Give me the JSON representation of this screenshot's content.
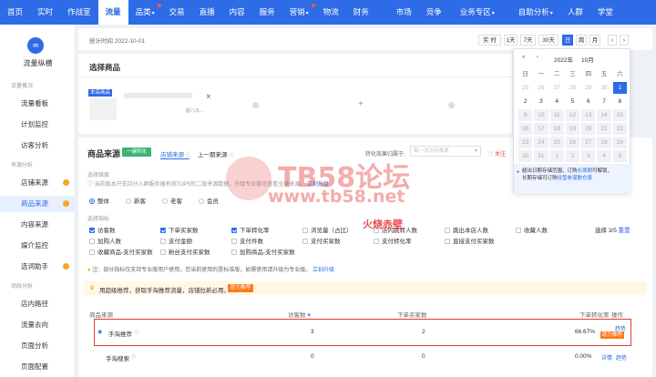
{
  "nav": {
    "items": [
      {
        "label": "首页"
      },
      {
        "label": "实时"
      },
      {
        "label": "作战室"
      },
      {
        "label": "流量",
        "active": true
      },
      {
        "label": "品类",
        "caret": true
      },
      {
        "label": "交易"
      },
      {
        "label": "直播"
      },
      {
        "label": "内容"
      },
      {
        "label": "服务"
      },
      {
        "label": "营销",
        "caret": true
      },
      {
        "label": "物流"
      },
      {
        "label": "财务"
      },
      {
        "label": "市场"
      },
      {
        "label": "竞争"
      },
      {
        "label": "业务专区",
        "caret": true
      },
      {
        "label": "自助分析",
        "caret": true
      },
      {
        "label": "人群"
      },
      {
        "label": "学堂"
      }
    ]
  },
  "sidebar": {
    "brand": "流量纵横",
    "groups": [
      {
        "label": "流量概况",
        "items": [
          "流量看板",
          "计划监控",
          "访客分析"
        ]
      },
      {
        "label": "来源分析",
        "items": [
          "店铺来源",
          "商品来源",
          "内容来源",
          "媒介监控",
          "选词助手"
        ]
      },
      {
        "label": "动线分析",
        "items": [
          "店内路径",
          "流量去向",
          "页面分析",
          "页面配置"
        ]
      }
    ],
    "active": "商品来源"
  },
  "stats_time": "统计时间 2022-10-01",
  "time_tabs": [
    "实 时",
    "1天",
    "7天",
    "30天",
    "日",
    "周",
    "月"
  ],
  "time_active": "日",
  "calendar": {
    "month_label": "2022年",
    "month": "10月",
    "weekdays": [
      "日",
      "一",
      "二",
      "三",
      "四",
      "五",
      "六"
    ],
    "rows": [
      [
        {
          "d": "25",
          "s": "prev"
        },
        {
          "d": "26",
          "s": "prev"
        },
        {
          "d": "27",
          "s": "prev"
        },
        {
          "d": "28",
          "s": "prev"
        },
        {
          "d": "29",
          "s": "prev"
        },
        {
          "d": "30",
          "s": "prev"
        },
        {
          "d": "1",
          "s": "sel"
        }
      ],
      [
        {
          "d": "2",
          "s": "n"
        },
        {
          "d": "3",
          "s": "n"
        },
        {
          "d": "4",
          "s": "n"
        },
        {
          "d": "5",
          "s": "n"
        },
        {
          "d": "6",
          "s": "n"
        },
        {
          "d": "7",
          "s": "n"
        },
        {
          "d": "8",
          "s": "n"
        }
      ],
      [
        {
          "d": "9",
          "s": "dis"
        },
        {
          "d": "10",
          "s": "dis"
        },
        {
          "d": "11",
          "s": "dis"
        },
        {
          "d": "12",
          "s": "dis"
        },
        {
          "d": "13",
          "s": "dis"
        },
        {
          "d": "14",
          "s": "dis"
        },
        {
          "d": "15",
          "s": "dis"
        }
      ],
      [
        {
          "d": "16",
          "s": "dis"
        },
        {
          "d": "17",
          "s": "dis"
        },
        {
          "d": "18",
          "s": "dis"
        },
        {
          "d": "19",
          "s": "dis"
        },
        {
          "d": "20",
          "s": "dis"
        },
        {
          "d": "21",
          "s": "dis"
        },
        {
          "d": "22",
          "s": "dis"
        }
      ],
      [
        {
          "d": "23",
          "s": "dis"
        },
        {
          "d": "24",
          "s": "dis"
        },
        {
          "d": "25",
          "s": "dis"
        },
        {
          "d": "26",
          "s": "dis"
        },
        {
          "d": "27",
          "s": "dis"
        },
        {
          "d": "28",
          "s": "dis"
        },
        {
          "d": "29",
          "s": "dis"
        }
      ],
      [
        {
          "d": "30",
          "s": "dis"
        },
        {
          "d": "31",
          "s": "dis"
        },
        {
          "d": "1",
          "s": "dis"
        },
        {
          "d": "2",
          "s": "dis"
        },
        {
          "d": "3",
          "s": "dis"
        },
        {
          "d": "4",
          "s": "dis"
        },
        {
          "d": "5",
          "s": "dis"
        }
      ]
    ],
    "note_a": "超出日期存储范围，订购",
    "note_link1": "长周期",
    "note_b": "可解锁，",
    "note_c": "长期存储可订购",
    "note_link2": "经营参谋数仓版"
  },
  "select_product": {
    "title": "选择商品",
    "item_tag": "本店商品",
    "item_name": "超八瓜..."
  },
  "source": {
    "title": "商品来源",
    "convert_btn": "一键转化",
    "tabs": [
      "店铺来源",
      "上一期来源"
    ],
    "attr_label": "转化效果归属于:",
    "attr_select": "每一次访问来源",
    "follow": "关注",
    "type_label": "选择维度",
    "notice": "当前版本只支持分入群服务器有效TOP5的二级来源数据，升级专业版可查看全量来源。",
    "notice_link": "立刻升级",
    "radios": [
      "整体",
      "新客",
      "老客",
      "会员"
    ],
    "metric_label": "选择指标",
    "metrics": [
      [
        {
          "t": "访客数",
          "on": true
        },
        {
          "t": "下单买家数",
          "on": true
        },
        {
          "t": "下单转化率",
          "on": true
        },
        {
          "t": "浏览量（占比）",
          "on": false
        },
        {
          "t": "店内跳转人数",
          "on": false
        },
        {
          "t": "跳出本店人数",
          "on": false
        },
        {
          "t": "收藏人数",
          "on": false
        }
      ],
      [
        {
          "t": "加购人数",
          "on": false
        },
        {
          "t": "支付金额",
          "on": false
        },
        {
          "t": "支付件数",
          "on": false
        },
        {
          "t": "支付买家数",
          "on": false
        },
        {
          "t": "支付转化率",
          "on": false
        },
        {
          "t": "直接支付买家数",
          "on": false
        }
      ],
      [
        {
          "t": "收藏商品-支付买家数",
          "on": false
        },
        {
          "t": "粉丝支付买家数",
          "on": false
        },
        {
          "t": "加购商品-支付买家数",
          "on": false
        }
      ]
    ],
    "metric_count": "选择 3/5",
    "reset": "重置",
    "tip": "注：部分指标仅支持专业版用户使用，您当前使用的是标准版，如需使用请升级为专业版。",
    "tip_link": "立刻升级",
    "promo_text": "用超级推荐，获取手淘推荐流量，店铺拉新必用。",
    "promo_btn": "助力推荐",
    "table": {
      "headers": [
        "商品来源",
        "访客数",
        "下单买家数",
        "下单转化率",
        "操作"
      ],
      "rows": [
        {
          "name": "手淘推荐",
          "v1": "3",
          "v2": "2",
          "v3": "66.67%",
          "op1": "趋势",
          "op2": "助力推荐"
        },
        {
          "name": "手淘搜索",
          "v1": "0",
          "v2": "0",
          "v3": "0.00%",
          "op1": "详情",
          "op2": "趋势"
        }
      ]
    }
  },
  "watermark": {
    "main": "TB58论坛",
    "url": "www.tb58.net",
    "sub": "火烧赤壁"
  },
  "colors": {
    "primary": "#2e6be6",
    "highlight": "#e53935",
    "green": "#3cb371",
    "orange": "#ff7a1a"
  }
}
